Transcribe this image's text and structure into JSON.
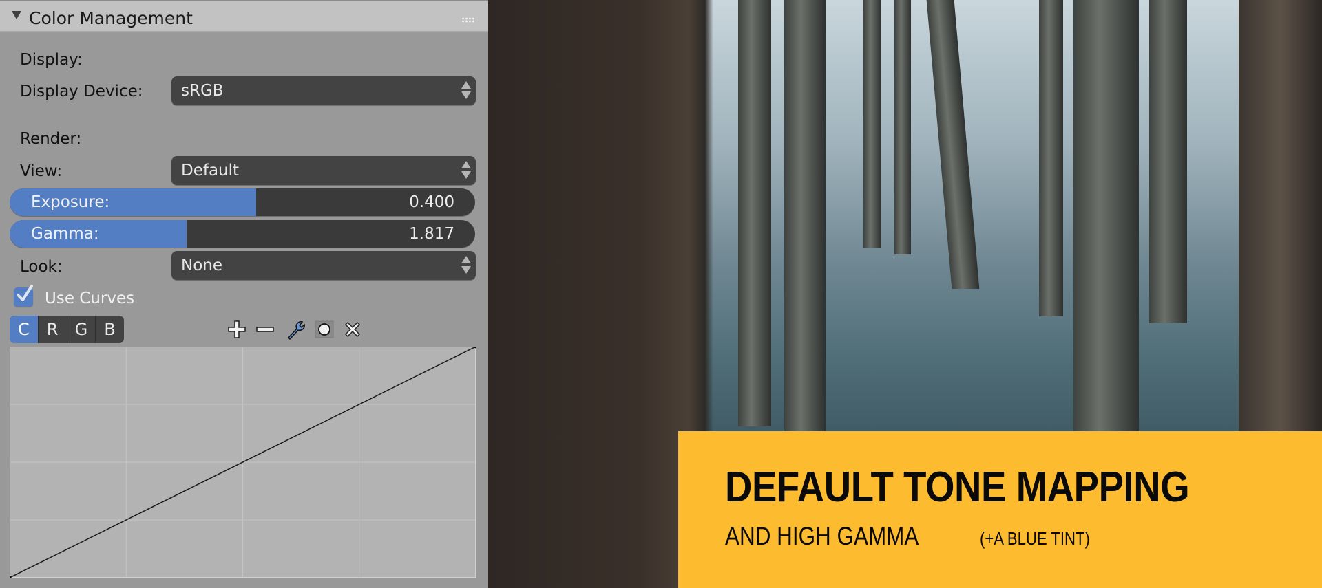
{
  "panel": {
    "title": "Color Management",
    "display_section_label": "Display:",
    "display_device_label": "Display Device:",
    "display_device_value": "sRGB",
    "render_section_label": "Render:",
    "view_label": "View:",
    "view_value": "Default",
    "exposure": {
      "label": "Exposure:",
      "value": "0.400",
      "fill_fraction": 0.53
    },
    "gamma": {
      "label": "Gamma:",
      "value": "1.817",
      "fill_fraction": 0.38
    },
    "look_label": "Look:",
    "look_value": "None",
    "use_curves": {
      "label": "Use Curves",
      "checked": true
    },
    "channels": [
      "C",
      "R",
      "G",
      "B"
    ],
    "active_channel": "C",
    "curve_tools": [
      "plus-icon",
      "minus-icon",
      "wrench-icon",
      "circle-icon",
      "x-icon"
    ],
    "curve_points": [
      [
        0,
        0
      ],
      [
        1,
        1
      ]
    ]
  },
  "banner": {
    "title": "DEFAULT TONE MAPPING",
    "subtitle": "AND HIGH GAMMA",
    "note": "(+A BLUE TINT)",
    "color": "#fdbb2f"
  },
  "colors": {
    "accent": "#547ec3",
    "widget_dark": "#434343",
    "panel_bg": "#999999"
  }
}
